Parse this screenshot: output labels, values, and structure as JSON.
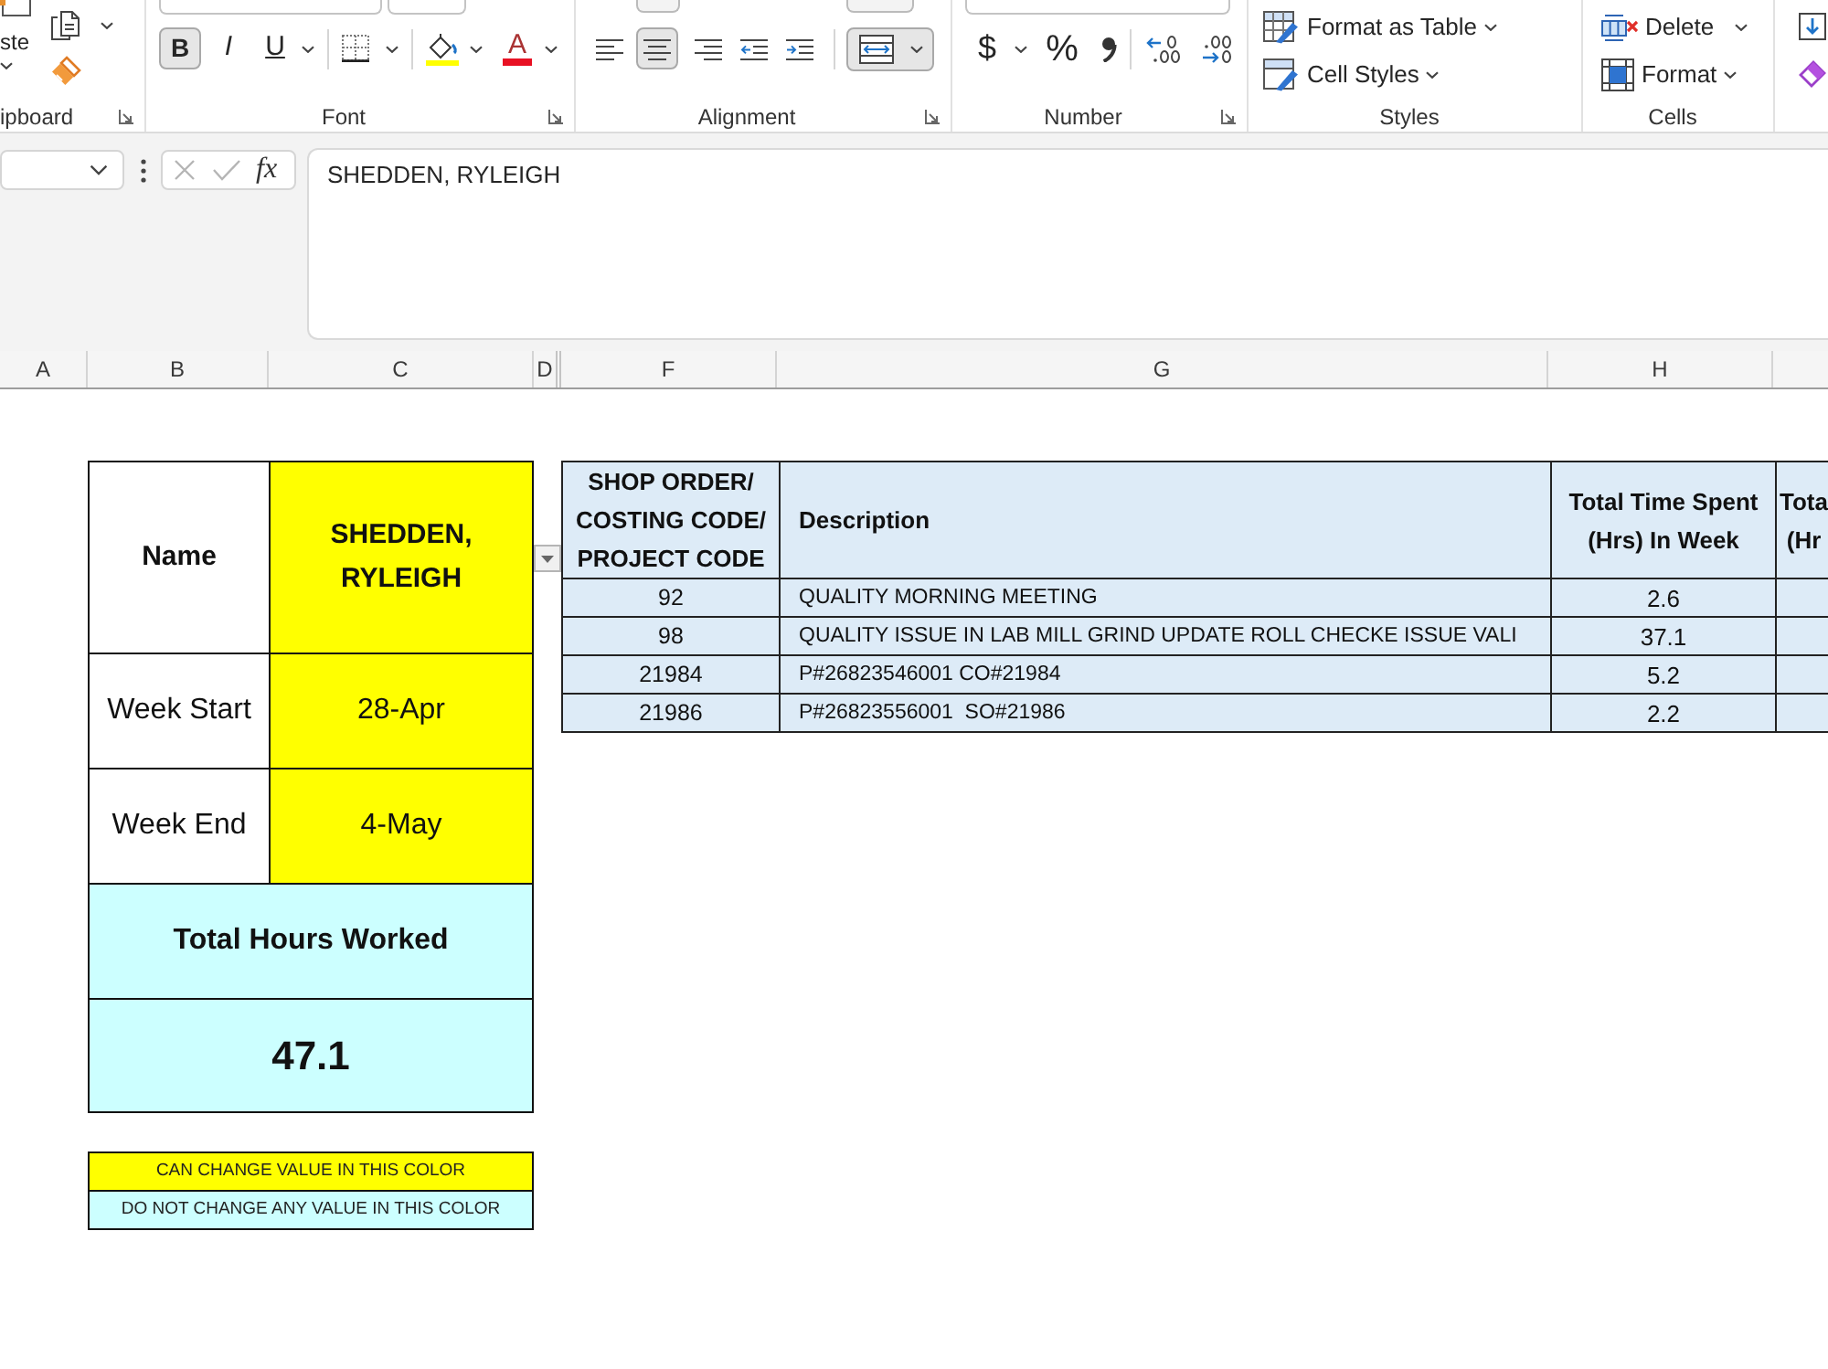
{
  "ribbon": {
    "clipboard": {
      "paste_label": "ste",
      "group_label": "ipboard"
    },
    "font": {
      "buttons": [
        {
          "kind": "bold",
          "label": "B",
          "pressed": true
        },
        {
          "kind": "italic",
          "label": "I",
          "pressed": false
        },
        {
          "kind": "underline",
          "label": "U",
          "pressed": false
        }
      ],
      "font_color_label": "A",
      "group_label": "Font"
    },
    "alignment": {
      "buttons": [
        {
          "kind": "align-left",
          "pressed": false
        },
        {
          "kind": "align-center",
          "pressed": true
        },
        {
          "kind": "align-right",
          "pressed": false
        },
        {
          "kind": "decrease-indent",
          "pressed": false
        },
        {
          "kind": "increase-indent",
          "pressed": false
        }
      ],
      "merge_center": {
        "pressed": true
      },
      "group_label": "Alignment"
    },
    "number": {
      "currency_label": "$",
      "percent_label": "%",
      "group_label": "Number"
    },
    "styles": {
      "commands": [
        {
          "kind": "format-table",
          "label": "Format as Table"
        },
        {
          "kind": "cell-styles",
          "label": "Cell Styles"
        }
      ],
      "group_label": "Styles"
    },
    "cells": {
      "commands": [
        {
          "kind": "delete",
          "label": "Delete"
        },
        {
          "kind": "format",
          "label": "Format"
        }
      ],
      "group_label": "Cells"
    }
  },
  "formula_bar": {
    "cancel": {
      "disabled": true
    },
    "enter": {
      "disabled": true
    },
    "function_label": "fx",
    "content": "SHEDDEN, RYLEIGH"
  },
  "column_headers": [
    "A",
    "B",
    "C",
    "D",
    "F",
    "G",
    "H"
  ],
  "summary": [
    {
      "kind": "name",
      "label": "Name",
      "value": "SHEDDEN, RYLEIGH",
      "editable": true
    },
    {
      "kind": "date",
      "label": "Week Start",
      "value": "28-Apr",
      "editable": true
    },
    {
      "kind": "date",
      "label": "Week End",
      "value": "4-May",
      "editable": true
    },
    {
      "kind": "heading",
      "text": "Total Hours Worked",
      "editable": false
    },
    {
      "kind": "total",
      "text": "47.1",
      "editable": false
    }
  ],
  "legend": [
    {
      "text": "CAN CHANGE VALUE IN THIS COLOR",
      "color": "#ffff00"
    },
    {
      "text": "DO NOT CHANGE ANY VALUE IN THIS COLOR",
      "color": "#ccffff"
    }
  ],
  "table": {
    "columns": [
      "SHOP ORDER/ COSTING CODE/ PROJECT CODE",
      "Description",
      "Total Time Spent (Hrs) In Week",
      "Tota (Hr"
    ],
    "rows": [
      {
        "code": "92",
        "description": "QUALITY MORNING MEETING",
        "hours": "2.6"
      },
      {
        "code": "98",
        "description": "QUALITY ISSUE IN LAB MILL GRIND UPDATE ROLL CHECKE ISSUE VALI",
        "hours": "37.1"
      },
      {
        "code": "21984",
        "description": "P#26823546001 CO#21984",
        "hours": "5.2"
      },
      {
        "code": "21986",
        "description": "P#26823556001  SO#21986",
        "hours": "2.2"
      }
    ]
  }
}
